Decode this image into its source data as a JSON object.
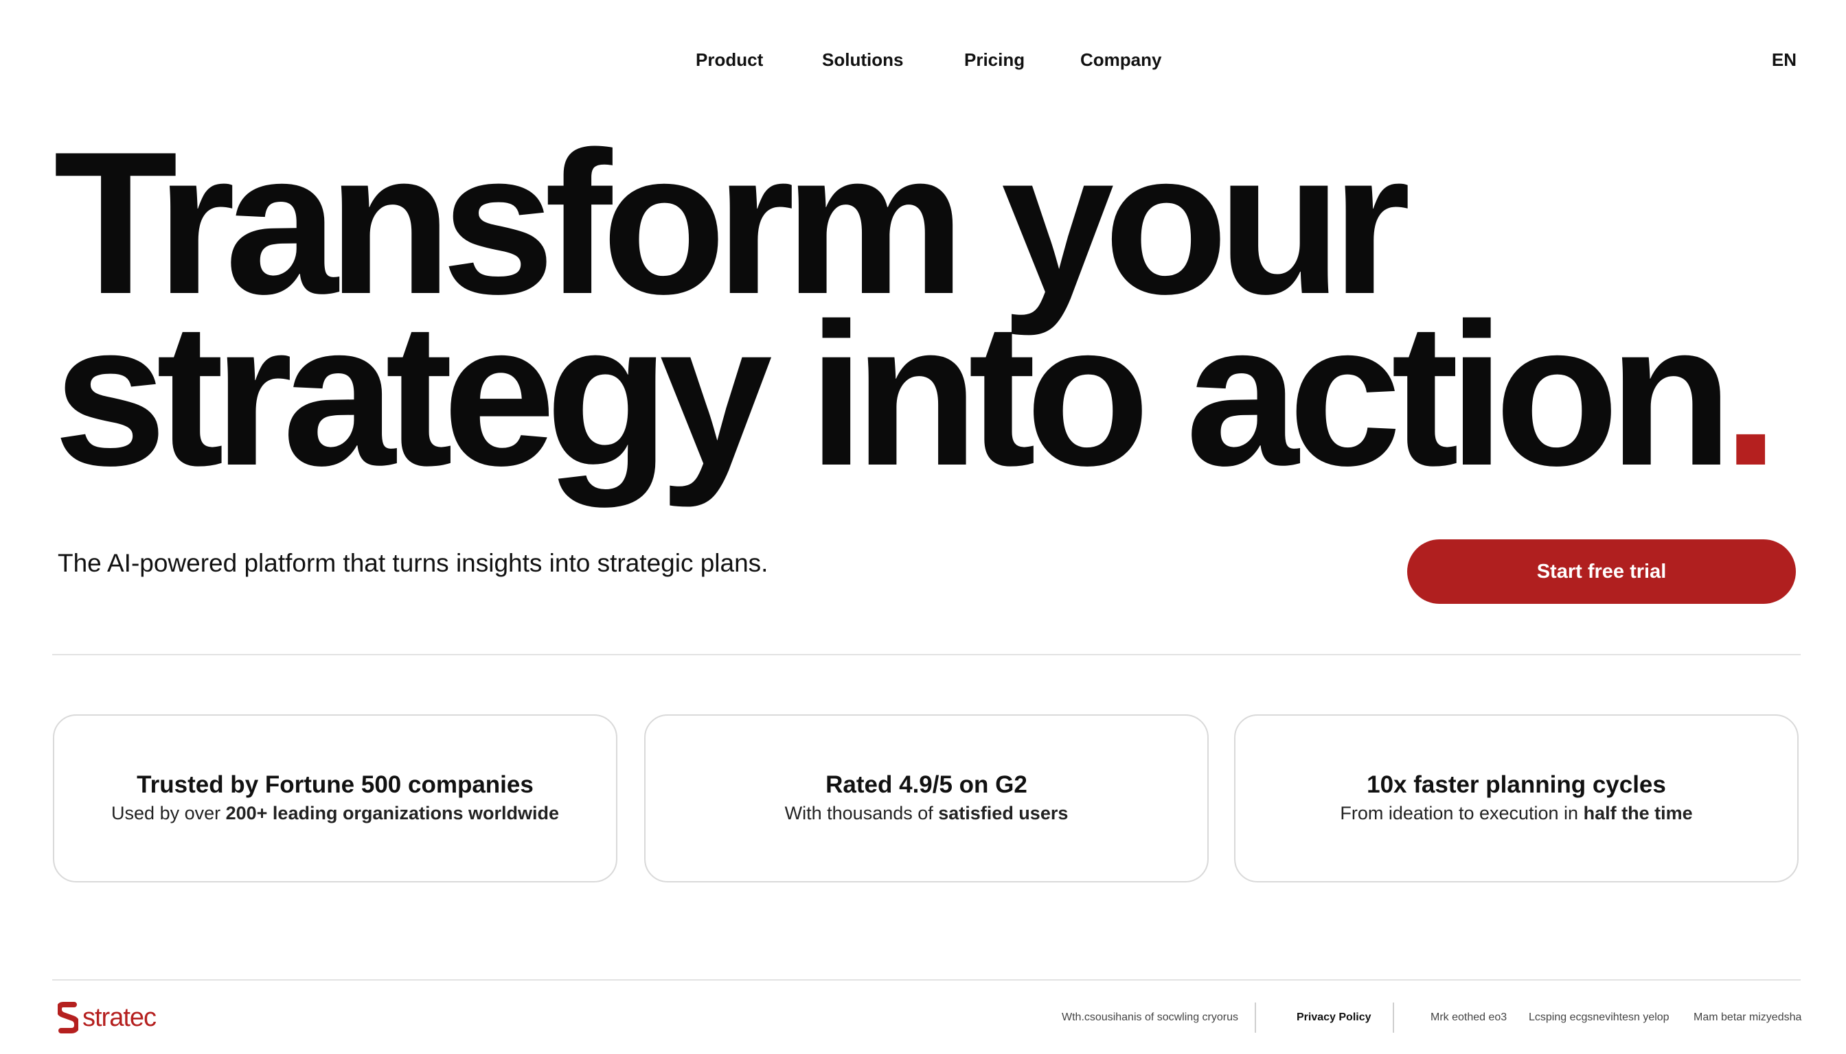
{
  "nav": {
    "items": [
      "Product",
      "Solutions",
      "Pricing",
      "Company"
    ],
    "language": "EN"
  },
  "hero": {
    "line1": "Transform your",
    "line2": "strategy into action",
    "dot": ".",
    "subline": "The AI-powered platform that turns insights into strategic plans.",
    "cta_label": "Start free trial"
  },
  "cards": [
    {
      "title": "Trusted by Fortune 500 companies",
      "desc_plain": "Used by over ",
      "desc_bold": "200+ leading organizations worldwide"
    },
    {
      "title": "Rated 4.9/5 on G2",
      "desc_plain": "With thousands of ",
      "desc_bold": "satisfied users"
    },
    {
      "title": "10x faster planning cycles",
      "desc_plain": "From ideation to execution in ",
      "desc_bold": "half the time"
    }
  ],
  "footer": {
    "logo_text": "stratec",
    "links": [
      "Wth.csousihanis of socwling cryorus",
      "Privacy Policy",
      "Mrk eothed eo3",
      "Lcsping ecgsnevihtesn yelop",
      "Mam betar mizyedsha"
    ]
  },
  "colors": {
    "accent": "#b01f1f",
    "text": "#0b0b0b",
    "border": "#d9d9d9"
  }
}
